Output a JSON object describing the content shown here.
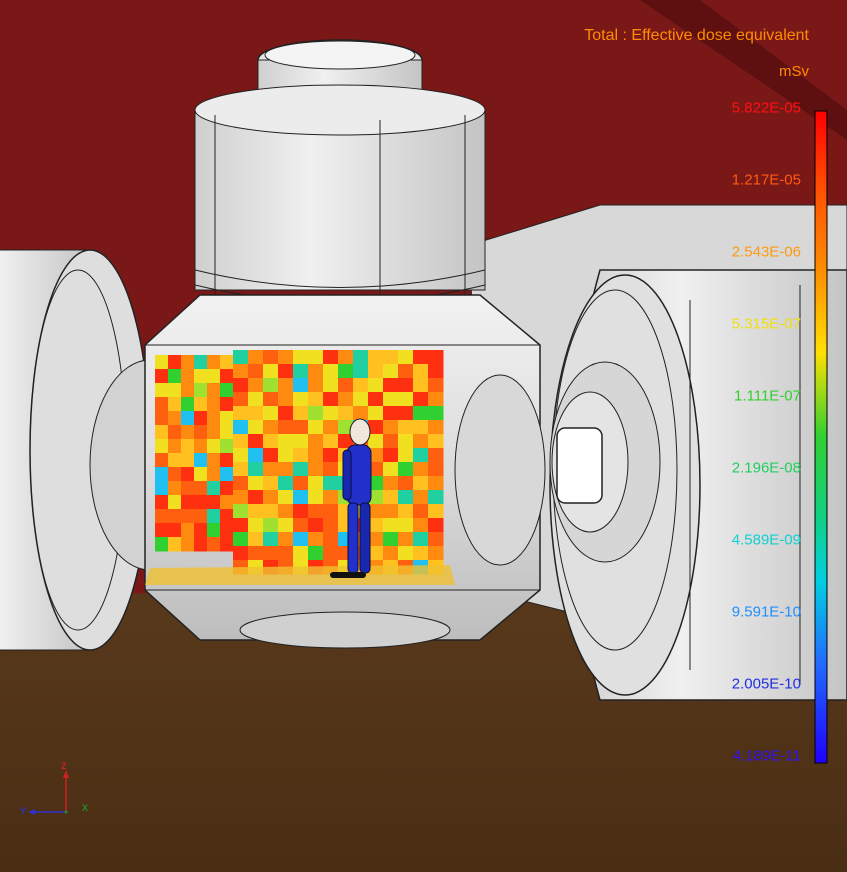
{
  "legend": {
    "title": "Total : Effective dose equivalent",
    "unit": "mSv",
    "title_color": "#ff8c00",
    "entries": [
      {
        "value": "5.822E-05",
        "color": "#ff1010"
      },
      {
        "value": "1.217E-05",
        "color": "#ff5a10"
      },
      {
        "value": "2.543E-06",
        "color": "#ff9a10"
      },
      {
        "value": "5.315E-07",
        "color": "#f0e010"
      },
      {
        "value": "1.111E-07",
        "color": "#30d030"
      },
      {
        "value": "2.196E-08",
        "color": "#20d060"
      },
      {
        "value": "4.589E-09",
        "color": "#10d0d0"
      },
      {
        "value": "9.591E-10",
        "color": "#2090ff"
      },
      {
        "value": "2.005E-10",
        "color": "#2030e0"
      },
      {
        "value": "4.189E-11",
        "color": "#3010f0"
      }
    ]
  },
  "axes": {
    "z": "Z",
    "y": "Y",
    "x": "X"
  },
  "colors": {
    "background": "#7a1818",
    "floor": "#4a2e14",
    "model": "#e8e8e8"
  }
}
